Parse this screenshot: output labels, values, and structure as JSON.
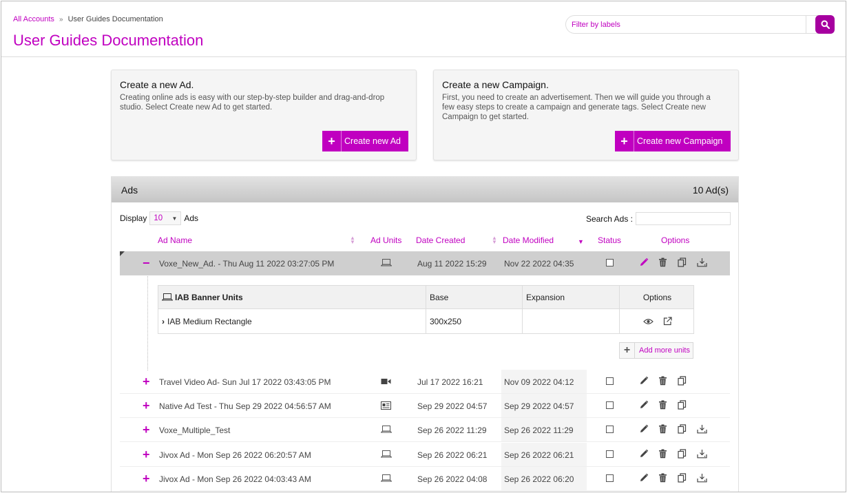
{
  "breadcrumb": {
    "root": "All Accounts",
    "separator": "»",
    "current": "User Guides Documentation"
  },
  "page_title": "User Guides Documentation",
  "filter": {
    "placeholder": "Filter by labels"
  },
  "cards": {
    "ad": {
      "title": "Create a new Ad.",
      "description": "Creating online ads is easy with our step-by-step builder and drag-and-drop studio. Select Create new Ad to get started.",
      "button": "Create new Ad"
    },
    "campaign": {
      "title": "Create a new Campaign.",
      "description": "First, you need to create an advertisement. Then we will guide you through a few easy steps to create a campaign and generate tags. Select Create new Campaign to get started.",
      "button": "Create new Campaign"
    }
  },
  "ads_panel": {
    "title": "Ads",
    "count": "10 Ad(s)",
    "display_label": "Display",
    "display_value": "10",
    "display_suffix": "Ads",
    "search_label": "Search Ads :",
    "columns": {
      "name": "Ad Name",
      "units": "Ad Units",
      "created": "Date Created",
      "modified": "Date Modified",
      "status": "Status",
      "options": "Options"
    },
    "rows": [
      {
        "name": "Voxe_New_Ad. - Thu Aug 11 2022 03:27:05 PM",
        "unit_icon": "laptop-icon",
        "created": "Aug 11 2022 15:29",
        "modified": "Nov 22 2022 04:35",
        "expanded": true,
        "has_export": true
      },
      {
        "name": "Travel Video Ad- Sun Jul 17 2022 03:43:05 PM",
        "unit_icon": "video-icon",
        "created": "Jul 17 2022 16:21",
        "modified": "Nov 09 2022 04:12",
        "expanded": false,
        "has_export": false
      },
      {
        "name": "Native Ad Test - Thu Sep 29 2022 04:56:57 AM",
        "unit_icon": "native-card-icon",
        "created": "Sep 29 2022 04:57",
        "modified": "Sep 29 2022 04:57",
        "expanded": false,
        "has_export": false
      },
      {
        "name": "Voxe_Multiple_Test",
        "unit_icon": "laptop-icon",
        "created": "Sep 26 2022 11:29",
        "modified": "Sep 26 2022 11:29",
        "expanded": false,
        "has_export": true
      },
      {
        "name": "Jivox Ad - Mon Sep 26 2022 06:20:57 AM",
        "unit_icon": "laptop-icon",
        "created": "Sep 26 2022 06:21",
        "modified": "Sep 26 2022 06:21",
        "expanded": false,
        "has_export": true
      },
      {
        "name": "Jivox Ad - Mon Sep 26 2022 04:03:43 AM",
        "unit_icon": "laptop-icon",
        "created": "Sep 26 2022 04:08",
        "modified": "Sep 26 2022 06:20",
        "expanded": false,
        "has_export": true
      }
    ],
    "expanded_detail": {
      "group_label": "IAB Banner Units",
      "col_base": "Base",
      "col_expansion": "Expansion",
      "col_options": "Options",
      "unit_name": "IAB Medium Rectangle",
      "unit_base": "300x250",
      "unit_expansion": "",
      "add_units_label": "Add more units"
    }
  },
  "colors": {
    "accent": "#c000c0",
    "header_gradient_top": "#e2e2e2",
    "header_gradient_bottom": "#c5c5c5",
    "selected_row": "#cfcfcf"
  }
}
